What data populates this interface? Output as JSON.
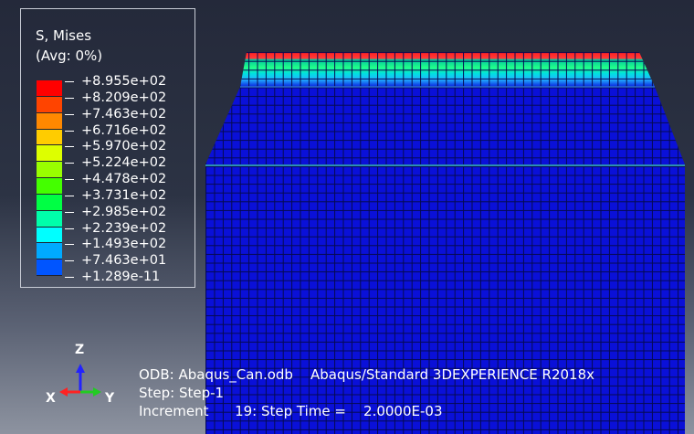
{
  "legend": {
    "title": "S, Mises",
    "subtitle": "(Avg: 0%)",
    "entries": [
      {
        "label": "+8.955e+02",
        "color": "#ff0000"
      },
      {
        "label": "+8.209e+02",
        "color": "#ff4400"
      },
      {
        "label": "+7.463e+02",
        "color": "#ff8800"
      },
      {
        "label": "+6.716e+02",
        "color": "#ffcc00"
      },
      {
        "label": "+5.970e+02",
        "color": "#ddff00"
      },
      {
        "label": "+5.224e+02",
        "color": "#99ff00"
      },
      {
        "label": "+4.478e+02",
        "color": "#44ff00"
      },
      {
        "label": "+3.731e+02",
        "color": "#00ff44"
      },
      {
        "label": "+2.985e+02",
        "color": "#00ffaa"
      },
      {
        "label": "+2.239e+02",
        "color": "#00ffff"
      },
      {
        "label": "+1.493e+02",
        "color": "#00aaff"
      },
      {
        "label": "+7.463e+01",
        "color": "#0055ff"
      },
      {
        "label": "+1.289e-11",
        "color": "#0000ff"
      }
    ]
  },
  "triad": {
    "z": "Z",
    "x": "X",
    "y": "Y"
  },
  "info": {
    "odb": "ODB: Abaqus_Can.odb    Abaqus/Standard 3DEXPERIENCE R2018x",
    "step": "Step: Step-1",
    "increment": "Increment      19: Step Time =    2.0000E-03"
  },
  "colors": {
    "mesh_fill": "#0a10d8",
    "mesh_line": "#050a50",
    "edge_highlight": "#2c8fb0"
  }
}
